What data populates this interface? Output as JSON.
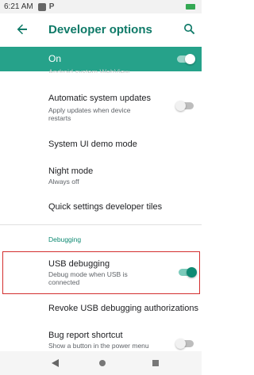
{
  "status_bar": {
    "time": "6:21 AM",
    "app_icon_letter": "P"
  },
  "app_bar": {
    "title": "Developer options",
    "back_icon": "arrow-back-icon",
    "search_icon": "search-icon"
  },
  "master_switch": {
    "label": "On",
    "state": "on"
  },
  "cutoff_text": "Android system WebView",
  "rows": {
    "auto_updates": {
      "title": "Automatic system updates",
      "subtitle": "Apply updates when device restarts",
      "state": "off"
    },
    "demo_mode": {
      "title": "System UI demo mode"
    },
    "night_mode": {
      "title": "Night mode",
      "subtitle": "Always off"
    },
    "quick_tiles": {
      "title": "Quick settings developer tiles"
    },
    "usb_debugging": {
      "title": "USB debugging",
      "subtitle": "Debug mode when USB is connected",
      "state": "on"
    },
    "revoke_usb": {
      "title": "Revoke USB debugging authorizations"
    },
    "bug_report": {
      "title": "Bug report shortcut",
      "subtitle": "Show a button in the power menu",
      "state": "off"
    }
  },
  "section": {
    "debugging": "Debugging"
  },
  "colors": {
    "accent": "#26a28a",
    "title_teal": "#0f7a68",
    "highlight": "#d32f2f"
  },
  "nav": {
    "back": "nav-back-icon",
    "home": "nav-home-icon",
    "recent": "nav-recent-icon"
  }
}
